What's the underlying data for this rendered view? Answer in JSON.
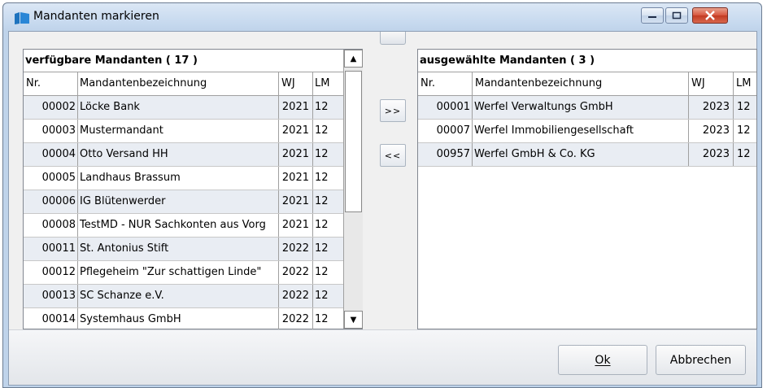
{
  "window": {
    "title": "Mandanten markieren",
    "colors": {
      "accent": "#1e73be",
      "close": "#c23a22",
      "rowAlt": "#e9edf3"
    }
  },
  "left": {
    "title": "verfügbare Mandanten ( 17 )",
    "headers": {
      "nr": "Nr.",
      "name": "Mandantenbezeichnung",
      "wj": "WJ",
      "lm": "LM"
    },
    "rows": [
      {
        "nr": "00002",
        "name": "Löcke Bank",
        "wj": "2021",
        "lm": "12"
      },
      {
        "nr": "00003",
        "name": "Mustermandant",
        "wj": "2021",
        "lm": "12"
      },
      {
        "nr": "00004",
        "name": "Otto Versand HH",
        "wj": "2021",
        "lm": "12"
      },
      {
        "nr": "00005",
        "name": "Landhaus Brassum",
        "wj": "2021",
        "lm": "12"
      },
      {
        "nr": "00006",
        "name": "IG Blütenwerder",
        "wj": "2021",
        "lm": "12"
      },
      {
        "nr": "00008",
        "name": "TestMD - NUR Sachkonten aus Vorg",
        "wj": "2021",
        "lm": "12"
      },
      {
        "nr": "00011",
        "name": "St. Antonius Stift",
        "wj": "2022",
        "lm": "12"
      },
      {
        "nr": "00012",
        "name": "Pflegeheim \"Zur schattigen Linde\"",
        "wj": "2022",
        "lm": "12"
      },
      {
        "nr": "00013",
        "name": "SC Schanze e.V.",
        "wj": "2022",
        "lm": "12"
      },
      {
        "nr": "00014",
        "name": "Systemhaus GmbH",
        "wj": "2022",
        "lm": "12"
      }
    ]
  },
  "right": {
    "title": "ausgewählte Mandanten ( 3 )",
    "headers": {
      "nr": "Nr.",
      "name": "Mandantenbezeichnung",
      "wj": "WJ",
      "lm": "LM"
    },
    "rows": [
      {
        "nr": "00001",
        "name": "Werfel Verwaltungs GmbH",
        "wj": "2023",
        "lm": "12"
      },
      {
        "nr": "00007",
        "name": "Werfel Immobiliengesellschaft",
        "wj": "2023",
        "lm": "12"
      },
      {
        "nr": "00957",
        "name": "Werfel GmbH & Co. KG",
        "wj": "2023",
        "lm": "12"
      }
    ]
  },
  "buttons": {
    "add": ">>",
    "remove": "<<",
    "ok": "Ok",
    "cancel": "Abbrechen",
    "scroll_up": "▲",
    "scroll_down": "▼"
  },
  "icons": {
    "app": "folder-icon",
    "minimize": "minimize-icon",
    "maximize": "maximize-icon",
    "close": "close-icon"
  }
}
